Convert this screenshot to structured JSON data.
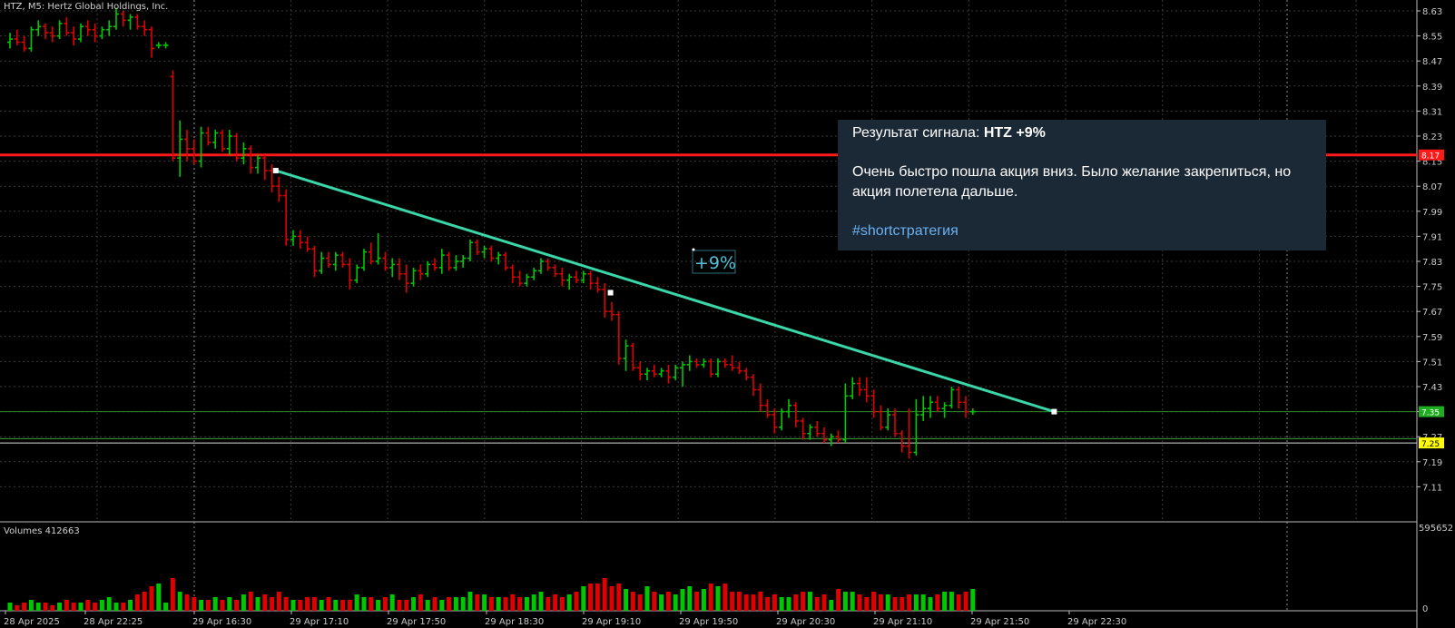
{
  "header": {
    "symbol_title": "HTZ, M5:  Hertz Global Holdings, Inc.",
    "volumes_label": "Volumes 412663"
  },
  "popup": {
    "title_prefix": "Результат сигнала: ",
    "title_bold": "HTZ +9%",
    "body": "Очень быстро пошла акция вниз. Было желание закрепиться, но акция полетела дальше.",
    "hashtag": "#shortстратегия"
  },
  "annotation": {
    "label": "+9%"
  },
  "price_tags": {
    "red_level": "8.17",
    "green_level": "7.35",
    "yellow_level": "7.25"
  },
  "colors": {
    "background": "#000000",
    "grid": "#3a3a3a",
    "bull": "#00c800",
    "bear": "#e00000",
    "trendline": "#3ad6a8",
    "red_line": "#ff1a1a",
    "green_line": "#2e8b2e",
    "yellow_tag": "#ffff00",
    "popup_bg": "#1b2836",
    "hashtag": "#6ab2f2",
    "annotation": "#4fc3d9"
  },
  "chart_data": {
    "type": "ohlc",
    "symbol": "HTZ",
    "timeframe": "M5",
    "y_ticks": [
      8.63,
      8.55,
      8.47,
      8.39,
      8.31,
      8.23,
      8.15,
      8.07,
      7.99,
      7.91,
      7.83,
      7.75,
      7.67,
      7.59,
      7.51,
      7.43,
      7.35,
      7.27,
      7.19,
      7.11
    ],
    "ylim": [
      7.04,
      8.65
    ],
    "x_ticks": [
      "28 Apr 2025",
      "28 Apr 22:25",
      "29 Apr 16:30",
      "29 Apr 17:10",
      "29 Apr 17:50",
      "29 Apr 18:30",
      "29 Apr 19:10",
      "29 Apr 19:50",
      "29 Apr 20:30",
      "29 Apr 21:10",
      "29 Apr 21:50",
      "29 Apr 22:30"
    ],
    "volume_ticks": [
      "595652",
      "0"
    ],
    "levels": [
      {
        "name": "red-level",
        "price": 8.17
      },
      {
        "name": "green-level",
        "price": 7.35
      },
      {
        "name": "yellow-level",
        "price": 7.25
      }
    ],
    "trendline": {
      "start": 8.12,
      "mid": 7.73,
      "end": 7.35,
      "start_bar": 36,
      "mid_bar": 82,
      "end_bar": 128
    },
    "bars": [
      {
        "o": 8.53,
        "h": 8.56,
        "l": 8.51,
        "c": 8.54
      },
      {
        "o": 8.54,
        "h": 8.57,
        "l": 8.52,
        "c": 8.53
      },
      {
        "o": 8.53,
        "h": 8.55,
        "l": 8.5,
        "c": 8.51
      },
      {
        "o": 8.51,
        "h": 8.58,
        "l": 8.5,
        "c": 8.57
      },
      {
        "o": 8.57,
        "h": 8.6,
        "l": 8.55,
        "c": 8.58
      },
      {
        "o": 8.58,
        "h": 8.59,
        "l": 8.54,
        "c": 8.56
      },
      {
        "o": 8.56,
        "h": 8.58,
        "l": 8.53,
        "c": 8.55
      },
      {
        "o": 8.55,
        "h": 8.6,
        "l": 8.54,
        "c": 8.59
      },
      {
        "o": 8.59,
        "h": 8.61,
        "l": 8.55,
        "c": 8.56
      },
      {
        "o": 8.56,
        "h": 8.58,
        "l": 8.52,
        "c": 8.54
      },
      {
        "o": 8.54,
        "h": 8.59,
        "l": 8.53,
        "c": 8.58
      },
      {
        "o": 8.58,
        "h": 8.6,
        "l": 8.55,
        "c": 8.57
      },
      {
        "o": 8.57,
        "h": 8.59,
        "l": 8.53,
        "c": 8.55
      },
      {
        "o": 8.55,
        "h": 8.58,
        "l": 8.54,
        "c": 8.57
      },
      {
        "o": 8.57,
        "h": 8.6,
        "l": 8.55,
        "c": 8.58
      },
      {
        "o": 8.58,
        "h": 8.64,
        "l": 8.57,
        "c": 8.62
      },
      {
        "o": 8.62,
        "h": 8.63,
        "l": 8.58,
        "c": 8.6
      },
      {
        "o": 8.6,
        "h": 8.62,
        "l": 8.57,
        "c": 8.61
      },
      {
        "o": 8.61,
        "h": 8.62,
        "l": 8.57,
        "c": 8.58
      },
      {
        "o": 8.58,
        "h": 8.6,
        "l": 8.55,
        "c": 8.57
      },
      {
        "o": 8.57,
        "h": 8.58,
        "l": 8.48,
        "c": 8.51
      },
      {
        "o": 8.52,
        "h": 8.53,
        "l": 8.51,
        "c": 8.52
      },
      {
        "o": 8.52,
        "h": 8.53,
        "l": 8.51,
        "c": 8.52
      },
      {
        "o": 8.42,
        "h": 8.44,
        "l": 8.15,
        "c": 8.16
      },
      {
        "o": 8.16,
        "h": 8.28,
        "l": 8.1,
        "c": 8.22
      },
      {
        "o": 8.22,
        "h": 8.25,
        "l": 8.15,
        "c": 8.19
      },
      {
        "o": 8.19,
        "h": 8.22,
        "l": 8.14,
        "c": 8.15
      },
      {
        "o": 8.15,
        "h": 8.26,
        "l": 8.13,
        "c": 8.24
      },
      {
        "o": 8.24,
        "h": 8.26,
        "l": 8.2,
        "c": 8.21
      },
      {
        "o": 8.21,
        "h": 8.25,
        "l": 8.19,
        "c": 8.24
      },
      {
        "o": 8.24,
        "h": 8.25,
        "l": 8.18,
        "c": 8.19
      },
      {
        "o": 8.19,
        "h": 8.25,
        "l": 8.17,
        "c": 8.23
      },
      {
        "o": 8.23,
        "h": 8.24,
        "l": 8.15,
        "c": 8.16
      },
      {
        "o": 8.16,
        "h": 8.21,
        "l": 8.14,
        "c": 8.19
      },
      {
        "o": 8.19,
        "h": 8.2,
        "l": 8.11,
        "c": 8.13
      },
      {
        "o": 8.13,
        "h": 8.17,
        "l": 8.11,
        "c": 8.16
      },
      {
        "o": 8.16,
        "h": 8.17,
        "l": 8.09,
        "c": 8.12
      },
      {
        "o": 8.12,
        "h": 8.14,
        "l": 8.05,
        "c": 8.07
      },
      {
        "o": 8.07,
        "h": 8.1,
        "l": 8.02,
        "c": 8.04
      },
      {
        "o": 8.04,
        "h": 8.06,
        "l": 7.88,
        "c": 7.9
      },
      {
        "o": 7.9,
        "h": 7.93,
        "l": 7.88,
        "c": 7.91
      },
      {
        "o": 7.91,
        "h": 7.93,
        "l": 7.87,
        "c": 7.89
      },
      {
        "o": 7.89,
        "h": 7.91,
        "l": 7.86,
        "c": 7.87
      },
      {
        "o": 7.87,
        "h": 7.88,
        "l": 7.78,
        "c": 7.8
      },
      {
        "o": 7.8,
        "h": 7.86,
        "l": 7.79,
        "c": 7.84
      },
      {
        "o": 7.84,
        "h": 7.86,
        "l": 7.81,
        "c": 7.82
      },
      {
        "o": 7.82,
        "h": 7.86,
        "l": 7.8,
        "c": 7.85
      },
      {
        "o": 7.85,
        "h": 7.86,
        "l": 7.81,
        "c": 7.82
      },
      {
        "o": 7.82,
        "h": 7.84,
        "l": 7.74,
        "c": 7.77
      },
      {
        "o": 7.77,
        "h": 7.82,
        "l": 7.76,
        "c": 7.81
      },
      {
        "o": 7.81,
        "h": 7.87,
        "l": 7.8,
        "c": 7.86
      },
      {
        "o": 7.86,
        "h": 7.89,
        "l": 7.82,
        "c": 7.83
      },
      {
        "o": 7.83,
        "h": 7.92,
        "l": 7.82,
        "c": 7.84
      },
      {
        "o": 7.84,
        "h": 7.86,
        "l": 7.8,
        "c": 7.81
      },
      {
        "o": 7.81,
        "h": 7.84,
        "l": 7.78,
        "c": 7.82
      },
      {
        "o": 7.82,
        "h": 7.84,
        "l": 7.77,
        "c": 7.79
      },
      {
        "o": 7.79,
        "h": 7.82,
        "l": 7.73,
        "c": 7.76
      },
      {
        "o": 7.76,
        "h": 7.81,
        "l": 7.75,
        "c": 7.8
      },
      {
        "o": 7.8,
        "h": 7.82,
        "l": 7.77,
        "c": 7.79
      },
      {
        "o": 7.79,
        "h": 7.83,
        "l": 7.78,
        "c": 7.82
      },
      {
        "o": 7.82,
        "h": 7.84,
        "l": 7.8,
        "c": 7.81
      },
      {
        "o": 7.81,
        "h": 7.87,
        "l": 7.79,
        "c": 7.85
      },
      {
        "o": 7.85,
        "h": 7.86,
        "l": 7.8,
        "c": 7.81
      },
      {
        "o": 7.81,
        "h": 7.85,
        "l": 7.8,
        "c": 7.83
      },
      {
        "o": 7.83,
        "h": 7.85,
        "l": 7.81,
        "c": 7.84
      },
      {
        "o": 7.84,
        "h": 7.9,
        "l": 7.83,
        "c": 7.89
      },
      {
        "o": 7.89,
        "h": 7.9,
        "l": 7.85,
        "c": 7.86
      },
      {
        "o": 7.86,
        "h": 7.88,
        "l": 7.84,
        "c": 7.87
      },
      {
        "o": 7.87,
        "h": 7.88,
        "l": 7.83,
        "c": 7.84
      },
      {
        "o": 7.84,
        "h": 7.86,
        "l": 7.82,
        "c": 7.85
      },
      {
        "o": 7.85,
        "h": 7.86,
        "l": 7.8,
        "c": 7.81
      },
      {
        "o": 7.81,
        "h": 7.82,
        "l": 7.76,
        "c": 7.78
      },
      {
        "o": 7.78,
        "h": 7.8,
        "l": 7.75,
        "c": 7.76
      },
      {
        "o": 7.76,
        "h": 7.79,
        "l": 7.75,
        "c": 7.78
      },
      {
        "o": 7.78,
        "h": 7.81,
        "l": 7.77,
        "c": 7.8
      },
      {
        "o": 7.8,
        "h": 7.84,
        "l": 7.79,
        "c": 7.83
      },
      {
        "o": 7.83,
        "h": 7.84,
        "l": 7.8,
        "c": 7.81
      },
      {
        "o": 7.81,
        "h": 7.82,
        "l": 7.78,
        "c": 7.79
      },
      {
        "o": 7.79,
        "h": 7.81,
        "l": 7.75,
        "c": 7.77
      },
      {
        "o": 7.77,
        "h": 7.79,
        "l": 7.74,
        "c": 7.78
      },
      {
        "o": 7.78,
        "h": 7.8,
        "l": 7.76,
        "c": 7.77
      },
      {
        "o": 7.77,
        "h": 7.8,
        "l": 7.76,
        "c": 7.79
      },
      {
        "o": 7.79,
        "h": 7.8,
        "l": 7.74,
        "c": 7.76
      },
      {
        "o": 7.76,
        "h": 7.78,
        "l": 7.73,
        "c": 7.74
      },
      {
        "o": 7.74,
        "h": 7.76,
        "l": 7.65,
        "c": 7.67
      },
      {
        "o": 7.67,
        "h": 7.7,
        "l": 7.64,
        "c": 7.66
      },
      {
        "o": 7.66,
        "h": 7.67,
        "l": 7.5,
        "c": 7.52
      },
      {
        "o": 7.52,
        "h": 7.58,
        "l": 7.48,
        "c": 7.56
      },
      {
        "o": 7.56,
        "h": 7.57,
        "l": 7.48,
        "c": 7.49
      },
      {
        "o": 7.49,
        "h": 7.51,
        "l": 7.45,
        "c": 7.47
      },
      {
        "o": 7.47,
        "h": 7.49,
        "l": 7.45,
        "c": 7.48
      },
      {
        "o": 7.48,
        "h": 7.5,
        "l": 7.46,
        "c": 7.47
      },
      {
        "o": 7.47,
        "h": 7.49,
        "l": 7.46,
        "c": 7.48
      },
      {
        "o": 7.48,
        "h": 7.5,
        "l": 7.44,
        "c": 7.46
      },
      {
        "o": 7.46,
        "h": 7.5,
        "l": 7.45,
        "c": 7.49
      },
      {
        "o": 7.49,
        "h": 7.51,
        "l": 7.43,
        "c": 7.5
      },
      {
        "o": 7.5,
        "h": 7.53,
        "l": 7.48,
        "c": 7.51
      },
      {
        "o": 7.51,
        "h": 7.52,
        "l": 7.49,
        "c": 7.5
      },
      {
        "o": 7.5,
        "h": 7.52,
        "l": 7.49,
        "c": 7.51
      },
      {
        "o": 7.51,
        "h": 7.52,
        "l": 7.46,
        "c": 7.47
      },
      {
        "o": 7.47,
        "h": 7.52,
        "l": 7.46,
        "c": 7.51
      },
      {
        "o": 7.51,
        "h": 7.52,
        "l": 7.49,
        "c": 7.5
      },
      {
        "o": 7.5,
        "h": 7.53,
        "l": 7.48,
        "c": 7.49
      },
      {
        "o": 7.49,
        "h": 7.51,
        "l": 7.47,
        "c": 7.48
      },
      {
        "o": 7.48,
        "h": 7.49,
        "l": 7.45,
        "c": 7.46
      },
      {
        "o": 7.46,
        "h": 7.47,
        "l": 7.4,
        "c": 7.42
      },
      {
        "o": 7.42,
        "h": 7.44,
        "l": 7.35,
        "c": 7.37
      },
      {
        "o": 7.37,
        "h": 7.39,
        "l": 7.33,
        "c": 7.34
      },
      {
        "o": 7.34,
        "h": 7.36,
        "l": 7.28,
        "c": 7.3
      },
      {
        "o": 7.3,
        "h": 7.36,
        "l": 7.29,
        "c": 7.35
      },
      {
        "o": 7.35,
        "h": 7.39,
        "l": 7.33,
        "c": 7.37
      },
      {
        "o": 7.37,
        "h": 7.38,
        "l": 7.3,
        "c": 7.32
      },
      {
        "o": 7.32,
        "h": 7.33,
        "l": 7.26,
        "c": 7.28
      },
      {
        "o": 7.28,
        "h": 7.31,
        "l": 7.26,
        "c": 7.3
      },
      {
        "o": 7.3,
        "h": 7.32,
        "l": 7.27,
        "c": 7.28
      },
      {
        "o": 7.28,
        "h": 7.3,
        "l": 7.25,
        "c": 7.26
      },
      {
        "o": 7.26,
        "h": 7.28,
        "l": 7.24,
        "c": 7.27
      },
      {
        "o": 7.27,
        "h": 7.29,
        "l": 7.25,
        "c": 7.26
      },
      {
        "o": 7.26,
        "h": 7.44,
        "l": 7.25,
        "c": 7.4
      },
      {
        "o": 7.4,
        "h": 7.46,
        "l": 7.39,
        "c": 7.44
      },
      {
        "o": 7.44,
        "h": 7.46,
        "l": 7.4,
        "c": 7.42
      },
      {
        "o": 7.42,
        "h": 7.46,
        "l": 7.38,
        "c": 7.4
      },
      {
        "o": 7.4,
        "h": 7.42,
        "l": 7.33,
        "c": 7.35
      },
      {
        "o": 7.35,
        "h": 7.37,
        "l": 7.29,
        "c": 7.3
      },
      {
        "o": 7.3,
        "h": 7.36,
        "l": 7.29,
        "c": 7.34
      },
      {
        "o": 7.34,
        "h": 7.36,
        "l": 7.27,
        "c": 7.28
      },
      {
        "o": 7.28,
        "h": 7.29,
        "l": 7.22,
        "c": 7.24
      },
      {
        "o": 7.24,
        "h": 7.36,
        "l": 7.2,
        "c": 7.22
      },
      {
        "o": 7.22,
        "h": 7.39,
        "l": 7.21,
        "c": 7.34
      },
      {
        "o": 7.34,
        "h": 7.4,
        "l": 7.32,
        "c": 7.36
      },
      {
        "o": 7.36,
        "h": 7.4,
        "l": 7.33,
        "c": 7.38
      },
      {
        "o": 7.38,
        "h": 7.4,
        "l": 7.35,
        "c": 7.36
      },
      {
        "o": 7.36,
        "h": 7.38,
        "l": 7.33,
        "c": 7.37
      },
      {
        "o": 7.37,
        "h": 7.43,
        "l": 7.36,
        "c": 7.42
      },
      {
        "o": 7.42,
        "h": 7.43,
        "l": 7.36,
        "c": 7.38
      },
      {
        "o": 7.38,
        "h": 7.4,
        "l": 7.33,
        "c": 7.35
      },
      {
        "o": 7.35,
        "h": 7.36,
        "l": 7.34,
        "c": 7.35
      }
    ],
    "volumes": [
      0.03,
      0.02,
      0.03,
      0.04,
      0.03,
      0.03,
      0.02,
      0.03,
      0.04,
      0.03,
      0.03,
      0.04,
      0.03,
      0.04,
      0.05,
      0.03,
      0.03,
      0.04,
      0.06,
      0.07,
      0.09,
      0.1,
      0.03,
      0.12,
      0.07,
      0.06,
      0.05,
      0.04,
      0.04,
      0.05,
      0.04,
      0.05,
      0.04,
      0.06,
      0.07,
      0.05,
      0.06,
      0.05,
      0.07,
      0.05,
      0.04,
      0.04,
      0.05,
      0.05,
      0.04,
      0.05,
      0.04,
      0.04,
      0.04,
      0.06,
      0.05,
      0.05,
      0.04,
      0.05,
      0.06,
      0.04,
      0.04,
      0.05,
      0.06,
      0.04,
      0.05,
      0.04,
      0.05,
      0.05,
      0.05,
      0.07,
      0.06,
      0.06,
      0.05,
      0.05,
      0.05,
      0.06,
      0.05,
      0.05,
      0.06,
      0.07,
      0.05,
      0.06,
      0.05,
      0.06,
      0.07,
      0.09,
      0.1,
      0.1,
      0.12,
      0.09,
      0.1,
      0.08,
      0.07,
      0.06,
      0.09,
      0.07,
      0.06,
      0.07,
      0.06,
      0.08,
      0.09,
      0.07,
      0.08,
      0.1,
      0.09,
      0.1,
      0.07,
      0.07,
      0.06,
      0.06,
      0.07,
      0.05,
      0.06,
      0.05,
      0.05,
      0.06,
      0.07,
      0.07,
      0.05,
      0.06,
      0.04,
      0.08,
      0.07,
      0.07,
      0.06,
      0.05,
      0.07,
      0.06,
      0.06,
      0.05,
      0.05,
      0.06,
      0.06,
      0.06,
      0.05,
      0.06,
      0.07,
      0.07,
      0.06,
      0.07,
      0.08,
      0.1,
      0.12,
      0.16,
      0.28
    ]
  }
}
